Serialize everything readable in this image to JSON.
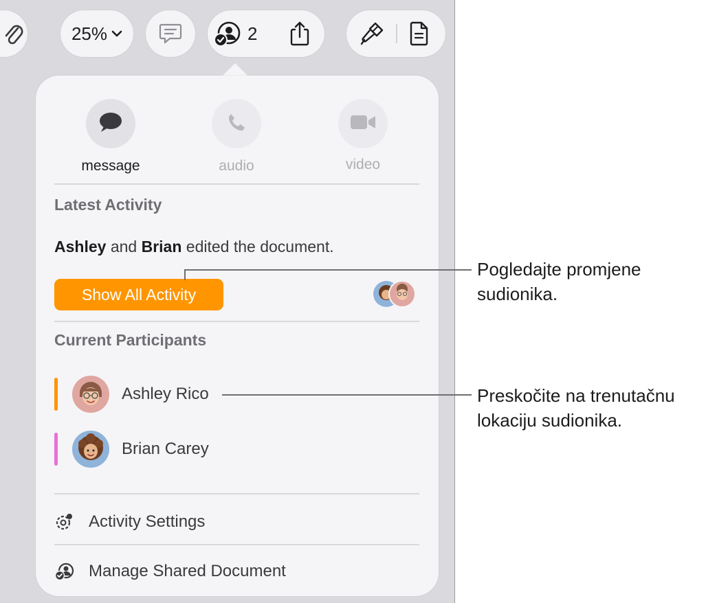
{
  "toolbar": {
    "zoom": "25%",
    "collab_count": "2"
  },
  "popover": {
    "actions": [
      {
        "label": "message"
      },
      {
        "label": "audio"
      },
      {
        "label": "video"
      }
    ],
    "latest_activity": {
      "title": "Latest Activity",
      "name1": "Ashley",
      "connector": " and ",
      "name2": "Brian",
      "rest": " edited the document.",
      "button": "Show All Activity"
    },
    "participants_title": "Current Participants",
    "participants": [
      {
        "name": "Ashley Rico",
        "color": "#ff9500"
      },
      {
        "name": "Brian Carey",
        "color": "#e96fd6"
      }
    ],
    "menu": [
      {
        "label": "Activity Settings",
        "icon": "activity-settings-icon"
      },
      {
        "label": "Manage Shared Document",
        "icon": "shared-document-icon"
      }
    ]
  },
  "callouts": {
    "first": {
      "line1": "Pogledajte promjene",
      "line2": "sudionika."
    },
    "second": {
      "line1": "Preskočite na trenutačnu",
      "line2": "lokaciju sudionika."
    }
  },
  "colors": {
    "accent": "#ff9500",
    "ashley": "#ff9500",
    "brian": "#e96fd6"
  }
}
